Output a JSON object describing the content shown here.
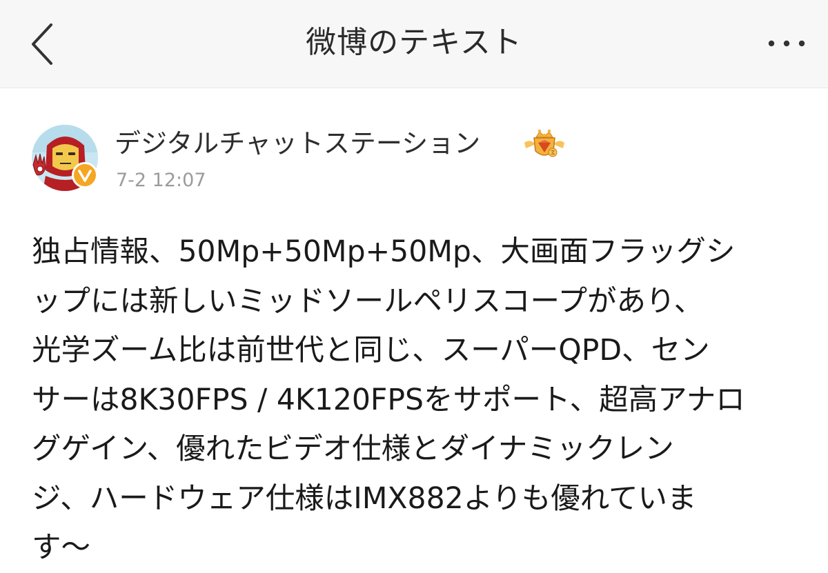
{
  "nav": {
    "title": "微博のテキスト",
    "back_icon": "chevron-left-icon",
    "more_icon": "ellipsis-icon",
    "more_label": "⋯"
  },
  "post": {
    "author": {
      "name": "デジタルチャットステーション",
      "avatar_icon": "iron-man-avatar-icon",
      "verified_badge": "verified-v-icon",
      "member_icon": "gold-crown-icon"
    },
    "time": "7-2 12:07",
    "lines": [
      "独占情報、50Mp+50Mp+50Mp、大画面フラッグシ",
      "ップには新しいミッドソールペリスコープがあり、",
      "光学ズーム比は前世代と同じ、スーパーQPD、セン",
      "サーは8K30FPS / 4K120FPSをサポート、超高アナロ",
      "グゲイン、優れたビデオ仕様とダイナミックレン",
      "ジ、ハードウェア仕様はIMX882よりも優れていま",
      "す～"
    ]
  },
  "colors": {
    "nav_background": "#f7f7f7",
    "text": "#1a1a1a",
    "time": "#9b9b9b",
    "verified": "#f5a623",
    "crown": "#f3b23c"
  }
}
